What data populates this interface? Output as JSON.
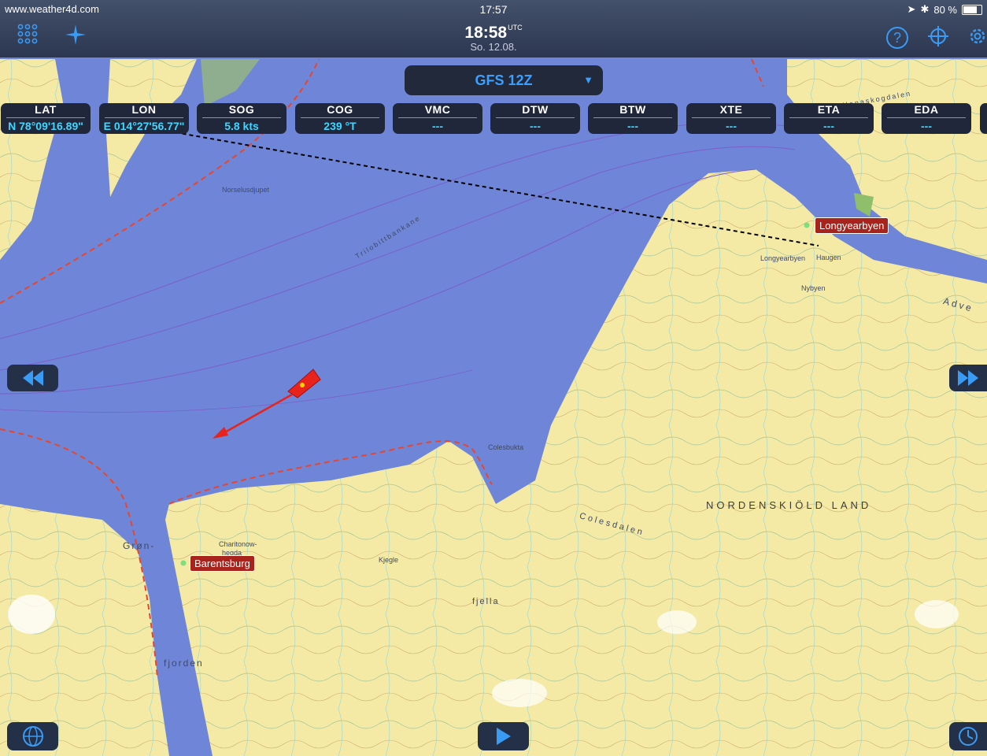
{
  "status_bar": {
    "website": "www.weather4d.com",
    "time": "17:57",
    "battery": "80 %"
  },
  "toolbar": {
    "clock": "18:58",
    "timezone": "UTC",
    "date": "So. 12.08."
  },
  "model_selector": {
    "label": "GFS 12Z"
  },
  "instruments": [
    {
      "label": "LAT",
      "value": "N  78°09'16.89\""
    },
    {
      "label": "LON",
      "value": "E 014°27'56.77\""
    },
    {
      "label": "SOG",
      "value": "5.8 kts"
    },
    {
      "label": "COG",
      "value": "239 °T"
    },
    {
      "label": "VMC",
      "value": "---"
    },
    {
      "label": "DTW",
      "value": "---"
    },
    {
      "label": "BTW",
      "value": "---"
    },
    {
      "label": "XTE",
      "value": "---"
    },
    {
      "label": "ETA",
      "value": "---"
    },
    {
      "label": "EDA",
      "value": "---"
    }
  ],
  "places": {
    "longyearbyen": "Longyearbyen",
    "barentsburg": "Barentsburg"
  },
  "map_labels": {
    "region": "NORDENSKIÖLD LAND",
    "colesdalen": "Colesdalen",
    "gron": "Grøn-",
    "fjorden": "fjorden",
    "longyearbyen_town": "Longyearbyen",
    "nybyen": "Nybyen",
    "haugen": "Haugen",
    "norselusdjupet": "Norselusdjupet",
    "trilobittbankane": "Trilobittbankane",
    "adve": "Adve",
    "hanaskogdalen": "Hanaskogdalen",
    "colesbukta": "Colesbukta",
    "kjegla": "Kjegle",
    "fjella": "fjella",
    "charitonow": "Charitonow-",
    "hegda": "hegda"
  },
  "colors": {
    "water": "#6f86d8",
    "land": "#f4eaa6",
    "accent": "#3a9bf5",
    "value": "#3fd6ff",
    "place_label": "#a8231c"
  }
}
